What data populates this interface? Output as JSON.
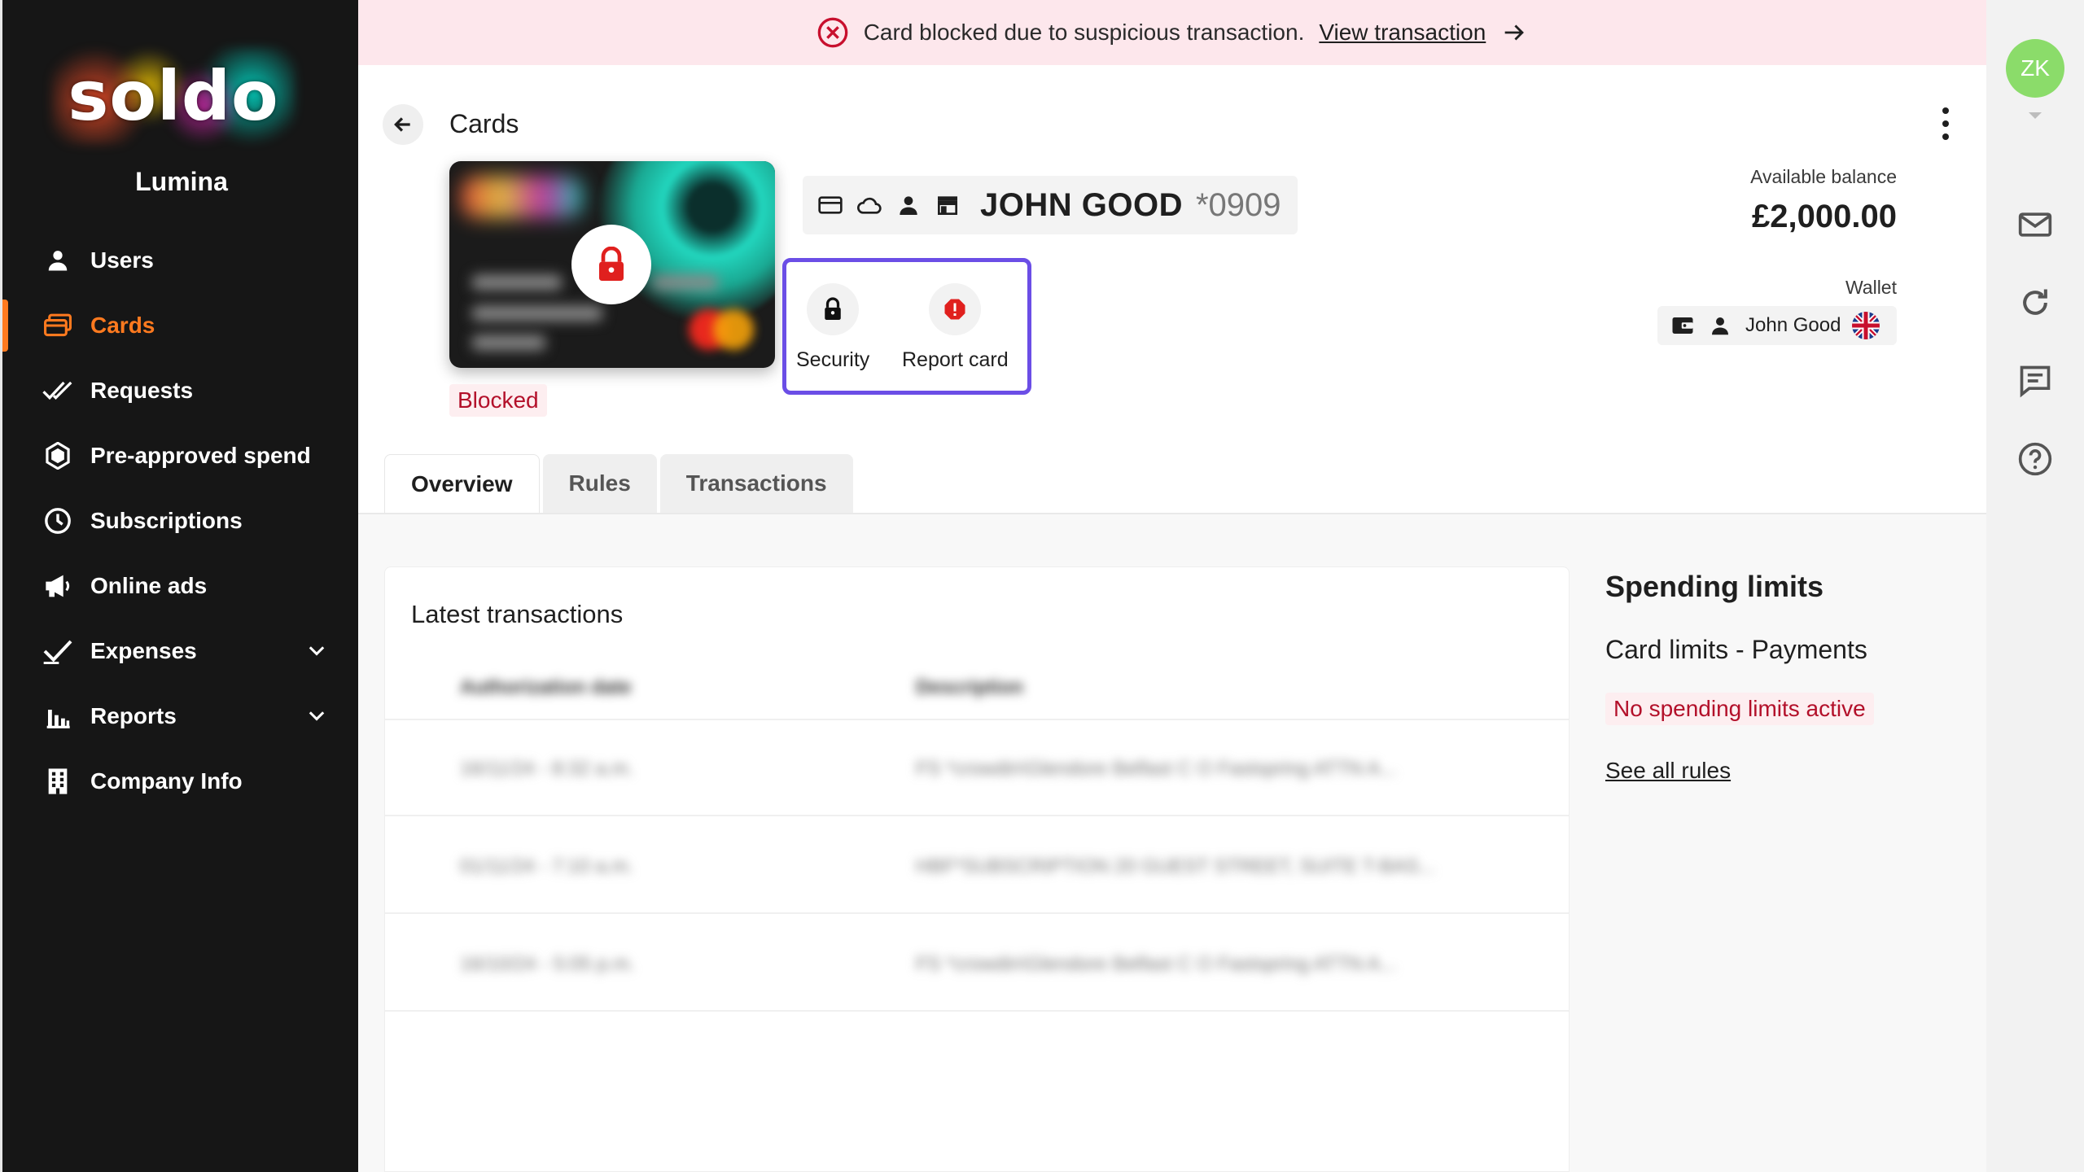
{
  "sidebar": {
    "logo_text": "soldo",
    "org_name": "Lumina",
    "items": [
      {
        "label": "Users",
        "icon": "user-icon"
      },
      {
        "label": "Cards",
        "icon": "cards-icon",
        "active": true
      },
      {
        "label": "Requests",
        "icon": "double-check-icon"
      },
      {
        "label": "Pre-approved spend",
        "icon": "hexagon-icon"
      },
      {
        "label": "Subscriptions",
        "icon": "clock-icon"
      },
      {
        "label": "Online ads",
        "icon": "megaphone-icon"
      },
      {
        "label": "Expenses",
        "icon": "check-pen-icon",
        "expandable": true
      },
      {
        "label": "Reports",
        "icon": "bar-chart-icon",
        "expandable": true
      },
      {
        "label": "Company Info",
        "icon": "building-icon"
      }
    ]
  },
  "banner": {
    "message": "Card blocked due to suspicious transaction.",
    "link_label": "View transaction",
    "icon": "error-circle-icon"
  },
  "header": {
    "title": "Cards"
  },
  "card": {
    "holder": "JOHN GOOD",
    "last4": "*0909",
    "status": "Blocked",
    "header_icons": [
      "card-icon",
      "cloud-icon",
      "person-icon",
      "store-icon"
    ]
  },
  "actions": [
    {
      "label": "Security",
      "icon": "lock-icon"
    },
    {
      "label": "Report card",
      "icon": "alert-icon"
    }
  ],
  "balance": {
    "label": "Available balance",
    "value": "£2,000.00"
  },
  "wallet": {
    "label": "Wallet",
    "owner": "John Good",
    "flag": "uk-flag-icon"
  },
  "tabs": [
    {
      "label": "Overview",
      "active": true
    },
    {
      "label": "Rules"
    },
    {
      "label": "Transactions"
    }
  ],
  "transactions": {
    "title": "Latest transactions",
    "columns": [
      "Authorization date",
      "Description"
    ],
    "rows": [
      {
        "date": "16/11/24 - 8:32 a.m.",
        "description": "FS *crowdin\\Glendore Belfast C O Fastspring ATTN A..."
      },
      {
        "date": "01/11/24 - 7:10 a.m.",
        "description": "HBF*SUBSCRIPTION 20 GUEST STREET, SUITE T-BAS..."
      },
      {
        "date": "16/10/24 - 5:05 p.m.",
        "description": "FS *crowdin\\Glendore Belfast C O Fastspring ATTN A..."
      }
    ]
  },
  "limits": {
    "title": "Spending limits",
    "subtitle": "Card limits - Payments",
    "badge": "No spending limits active",
    "link": "See all rules"
  },
  "rail": {
    "avatar_initials": "ZK",
    "avatar_color": "#8bdc6a",
    "icons": [
      "mail-icon",
      "refresh-icon",
      "chat-icon",
      "help-icon"
    ]
  },
  "colors": {
    "accent": "#ff7a1f",
    "highlight_box": "#6b4ee6",
    "error": "#b3102a",
    "banner_bg": "#fde7ec"
  }
}
